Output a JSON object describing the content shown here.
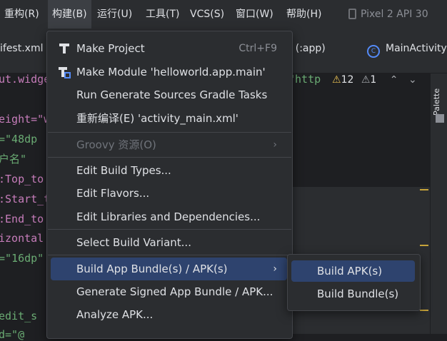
{
  "menubar": {
    "items": [
      {
        "label": "重构(R)"
      },
      {
        "label": "构建(B)"
      },
      {
        "label": "运行(U)"
      },
      {
        "label": "工具(T)"
      },
      {
        "label": "VCS(S)"
      },
      {
        "label": "窗口(W)"
      },
      {
        "label": "帮助(H)"
      }
    ],
    "device": "Pixel 2 API 30"
  },
  "tabs": {
    "manifest": "ifest.xml",
    "app": "s (:app)",
    "main_activity": "MainActivity"
  },
  "editor": {
    "lines": [
      "ut.widge",
      "eight=\"w",
      "=\"48dp",
      "户名\"",
      ":Top_to",
      ":Start_t",
      ":End_to",
      "izontal",
      "=\"16dp\"",
      "edit_s",
      "d=\"@",
      "\"http"
    ],
    "warnings_count": "12",
    "weak_warnings_count": "1"
  },
  "right_panel": {
    "palette": "Palette"
  },
  "build_menu": {
    "make_project": {
      "label": "Make Project",
      "shortcut": "Ctrl+F9"
    },
    "make_module": {
      "label": "Make Module 'helloworld.app.main'"
    },
    "run_generate": {
      "label": "Run Generate Sources Gradle Tasks"
    },
    "recompile": {
      "label": "重新编译(E) 'activity_main.xml'"
    },
    "groovy": {
      "label": "Groovy 资源(O)"
    },
    "edit_build_types": {
      "label": "Edit Build Types..."
    },
    "edit_flavors": {
      "label": "Edit Flavors..."
    },
    "edit_libraries": {
      "label": "Edit Libraries and Dependencies..."
    },
    "select_variant": {
      "label": "Select Build Variant..."
    },
    "build_bundle_apk": {
      "label": "Build App Bundle(s) / APK(s)"
    },
    "generate_signed": {
      "label": "Generate Signed App Bundle / APK..."
    },
    "analyze_apk": {
      "label": "Analyze APK..."
    }
  },
  "build_submenu": {
    "build_apk": "Build APK(s)",
    "build_bundle": "Build Bundle(s)"
  },
  "colors": {
    "background": "#1e1f22",
    "menu_bg": "#2b2d30",
    "highlight": "#2e436e",
    "string": "#6aab73",
    "warning": "#e8c053"
  }
}
